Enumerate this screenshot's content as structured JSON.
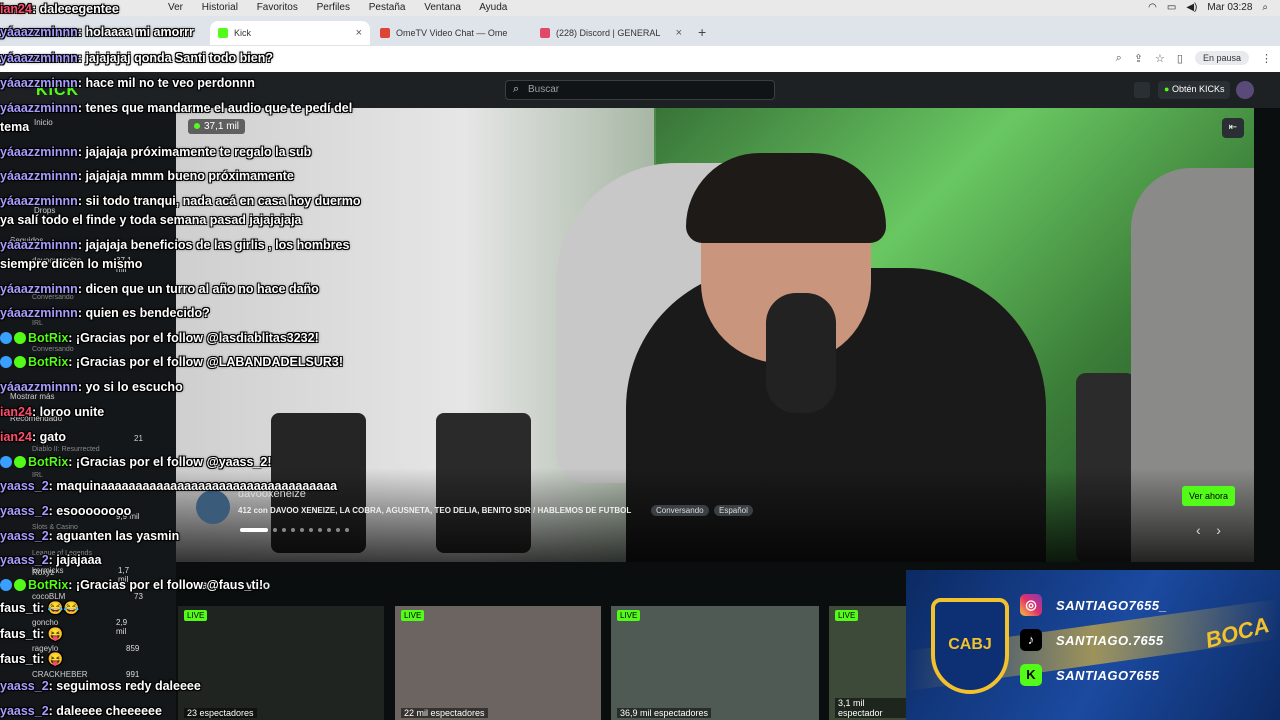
{
  "os_menubar": {
    "menus": [
      "Ver",
      "Historial",
      "Favoritos",
      "Perfiles",
      "Pestaña",
      "Ventana",
      "Ayuda"
    ],
    "clock": "Mar 03:28"
  },
  "tabs": [
    {
      "label": "Kick",
      "active": true
    },
    {
      "label": "OmeTV Video Chat — Ome",
      "active": false
    },
    {
      "label": "(228) Discord | GENERAL",
      "active": false
    }
  ],
  "browser": {
    "pause_label": "En pausa"
  },
  "kick": {
    "search_placeholder": "Buscar",
    "obten_label": "Obtén KICKs",
    "sidebar": {
      "home": "Inicio",
      "drops": "Drops",
      "followed_title": "Seguidos",
      "rows": [
        {
          "name": "davooxeneize",
          "viewers": "37,1 mil",
          "sub": "Conversando"
        },
        {
          "name": "IRL",
          "viewers": "",
          "sub": "Conversando"
        },
        {
          "name": "Mostrar más",
          "viewers": "",
          "sub": ""
        },
        {
          "name": "Recomendado",
          "viewers": "",
          "sub": ""
        },
        {
          "name": "Diablo II: Resurrected",
          "viewers": "21",
          "sub": ""
        },
        {
          "name": "IRL",
          "viewers": "",
          "sub": ""
        },
        {
          "name": "Slots & Casino",
          "viewers": "9,9 mil",
          "sub": ""
        },
        {
          "name": "League of Legends",
          "viewers": "",
          "sub": ""
        },
        {
          "name": "Roxyz",
          "viewers": "",
          "sub": ""
        },
        {
          "name": "kermicks",
          "viewers": "1,7 mil",
          "sub": ""
        },
        {
          "name": "cocoBLM",
          "viewers": "73",
          "sub": ""
        },
        {
          "name": "goncho",
          "viewers": "2,9 mil",
          "sub": ""
        },
        {
          "name": "rageylo",
          "viewers": "859",
          "sub": ""
        },
        {
          "name": "CRACKHEBER",
          "viewers": "991",
          "sub": ""
        }
      ]
    },
    "hero": {
      "viewers": "37,1 mil",
      "streamer": "davooxeneize",
      "title": "412 con DAVOO XENEIZE, LA COBRA, AGUSNETA, TEO DELIA, BENITO SDR / HABLEMOS DE FUTBOL",
      "tags": [
        "Conversando",
        "Español"
      ],
      "watch_label": "Ver ahora"
    },
    "section_title": "Streams en vivo",
    "thumbs": [
      {
        "live": "LIVE",
        "specs": "23 espectadores"
      },
      {
        "live": "LIVE",
        "specs": "22 mil espectadores"
      },
      {
        "live": "LIVE",
        "specs": "36,9 mil espectadores"
      },
      {
        "live": "LIVE",
        "specs": "3,1 mil espectador"
      }
    ]
  },
  "overlay": {
    "crest_text": "CABJ",
    "boca_word": "BOCA",
    "socials": [
      {
        "icon": "instagram-icon",
        "handle": "SANTIAGO7655_"
      },
      {
        "icon": "tiktok-icon",
        "handle": "SANTIAGO.7655"
      },
      {
        "icon": "kick-icon",
        "handle": "SANTIAGO7655"
      }
    ]
  },
  "chat": [
    {
      "user": "ian24",
      "color": "#ff4d6d",
      "text": ": daleeegentee"
    },
    {
      "user": "yáaazzminnn",
      "color": "#a79cff",
      "text": ": holaaaa mi amorrr"
    },
    {
      "user": "yáaazzminnn",
      "color": "#a79cff",
      "text": ": jajajajaj qonda Santi todo bien?"
    },
    {
      "user": "yáaazzminnn",
      "color": "#a79cff",
      "text": ": hace mil no te veo perdonnn"
    },
    {
      "user": "yáaazzminnn",
      "color": "#a79cff",
      "text": ": tenes que mandarme el audio que te pedí del"
    },
    {
      "user": "",
      "color": "#ffffff",
      "text": "tema"
    },
    {
      "user": "yáaazzminnn",
      "color": "#a79cff",
      "text": ": jajajaja próximamente te regalo la sub"
    },
    {
      "user": "yáaazzminnn",
      "color": "#a79cff",
      "text": ": jajajaja mmm bueno próximamente"
    },
    {
      "user": "yáaazzminnn",
      "color": "#a79cff",
      "text": ": sii todo tranqui, nada acá en casa hoy duermo"
    },
    {
      "user": "",
      "color": "#ffffff",
      "text": "ya salí todo el finde y toda semana pasad jajajajaja"
    },
    {
      "user": "yáaazzminnn",
      "color": "#a79cff",
      "text": ": jajajaja beneficios de las girlis , los hombres"
    },
    {
      "user": "",
      "color": "#ffffff",
      "text": "siempre dicen lo mismo"
    },
    {
      "user": "yáaazzminnn",
      "color": "#a79cff",
      "text": ": dicen que un turro al año no hace daño"
    },
    {
      "user": "yáaazzminnn",
      "color": "#a79cff",
      "text": ": quien es bendecido?"
    },
    {
      "user": "BotRix",
      "color": "#53fc18",
      "text": ": ¡Gracias por el follow @lasdiablitas3232!"
    },
    {
      "user": "BotRix",
      "color": "#53fc18",
      "text": ": ¡Gracias por el follow @LABANDADELSUR3!"
    },
    {
      "user": "yáaazzminnn",
      "color": "#a79cff",
      "text": ": yo si lo escucho"
    },
    {
      "user": "ian24",
      "color": "#ff4d6d",
      "text": ": loroo unite"
    },
    {
      "user": "ian24",
      "color": "#ff4d6d",
      "text": ": gato"
    },
    {
      "user": "BotRix",
      "color": "#53fc18",
      "text": ": ¡Gracias por el follow @yaass_2!"
    },
    {
      "user": "yaass_2",
      "color": "#a79cff",
      "text": ": maquinaaaaaaaaaaaaaaaaaaaaaaaaaaaaaaaaaa"
    },
    {
      "user": "yaass_2",
      "color": "#a79cff",
      "text": ": esoooooooo"
    },
    {
      "user": "yaass_2",
      "color": "#a79cff",
      "text": ": aguanten las yasmin"
    },
    {
      "user": "yaass_2",
      "color": "#a79cff",
      "text": ": jajajaaa"
    },
    {
      "user": "BotRix",
      "color": "#53fc18",
      "text": ": ¡Gracias por el follow @faus_ti!"
    },
    {
      "user": "faus_ti",
      "color": "#ffffff",
      "text": ": 😂😂"
    },
    {
      "user": "faus_ti",
      "color": "#ffffff",
      "text": ": 😝"
    },
    {
      "user": "faus_ti",
      "color": "#ffffff",
      "text": ": 😝"
    },
    {
      "user": "yaass_2",
      "color": "#a79cff",
      "text": ": seguimoss redy daleeee"
    },
    {
      "user": "yaass_2",
      "color": "#a79cff",
      "text": ": daleeee cheeeeee"
    }
  ]
}
